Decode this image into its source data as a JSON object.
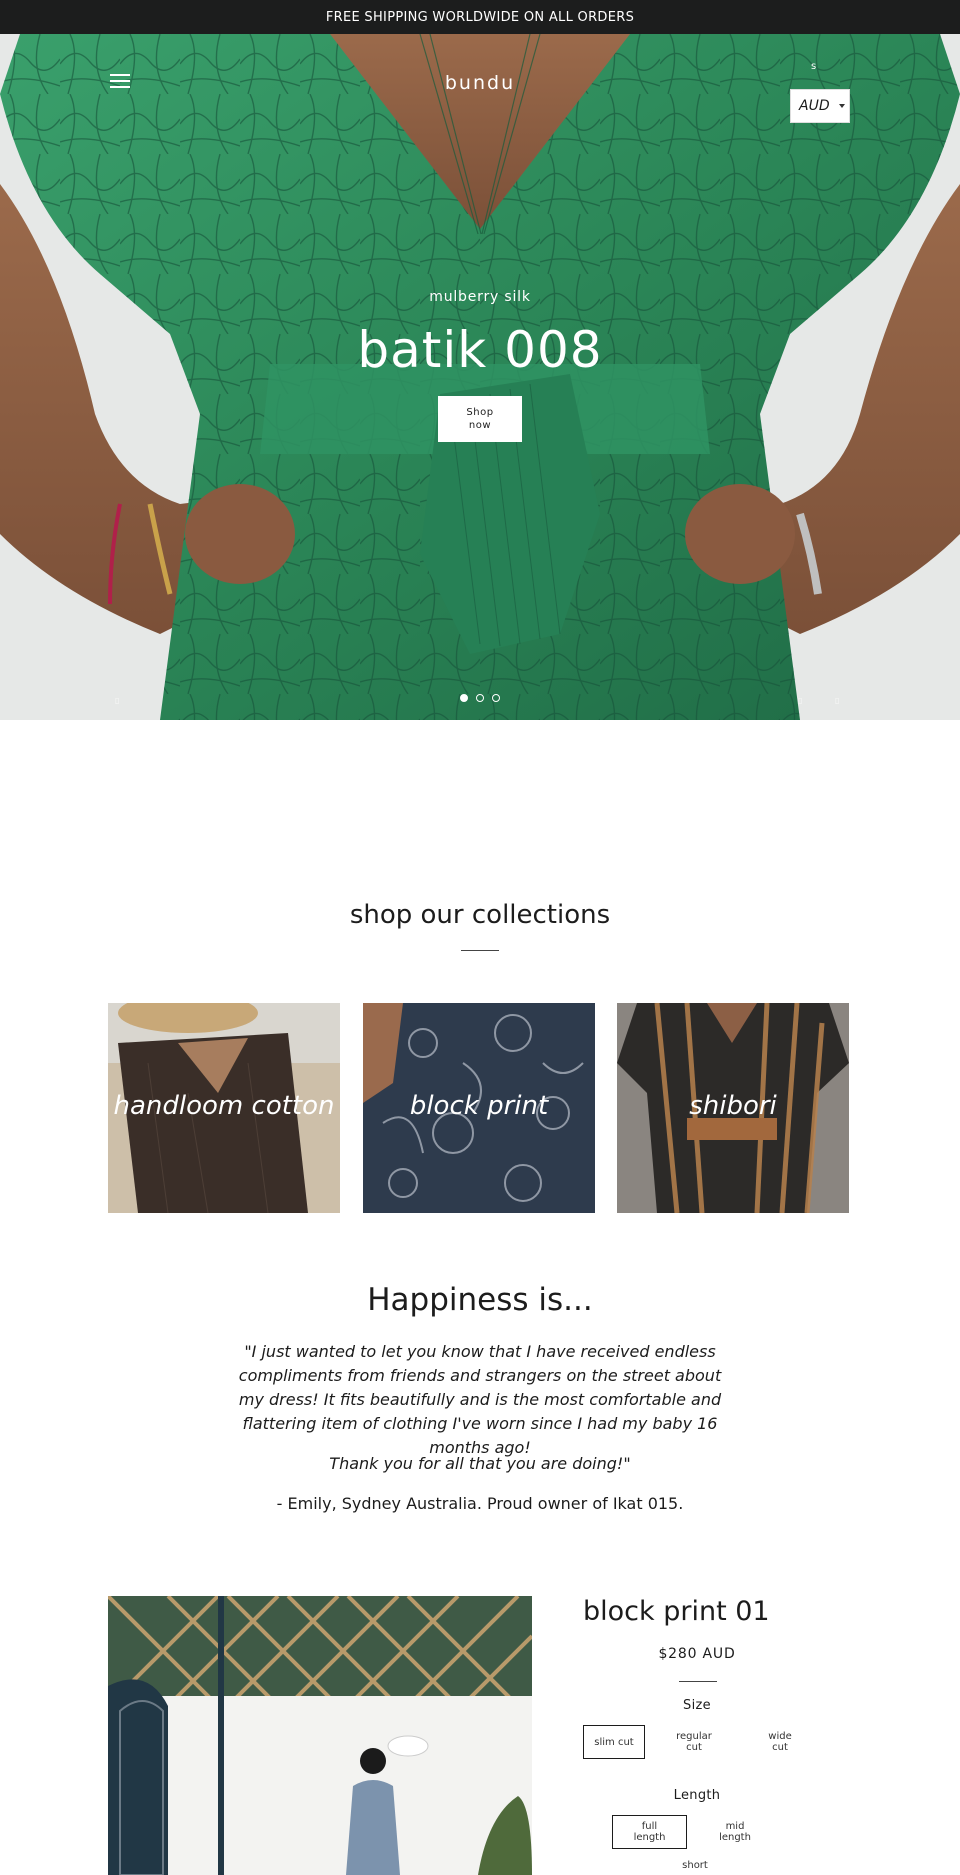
{
  "announcement": "FREE SHIPPING WORLDWIDE ON ALL ORDERS",
  "header": {
    "logo": "bundu",
    "cart_count": "s",
    "currency": "AUD"
  },
  "hero": {
    "subtitle": "mulberry silk",
    "title": "batik 008",
    "button": "Shop now",
    "slides_total": 3,
    "active_slide": 1
  },
  "collections": {
    "title": "shop our collections",
    "items": [
      {
        "label": "handloom cotton"
      },
      {
        "label": "block print"
      },
      {
        "label": "shibori"
      }
    ]
  },
  "testimonial": {
    "title": "Happiness is...",
    "quote": "\"I just wanted to let you know that I have received endless compliments from friends and strangers on the street about my dress! It fits beautifully and is the most comfortable and flattering item of clothing I've worn since I had my baby 16 months ago!",
    "quote2": "Thank you for all that you are doing!\"",
    "attribution": "- Emily, Sydney Australia. Proud owner of Ikat 015."
  },
  "product": {
    "title": "block print 01",
    "price": "$280 AUD",
    "size_label": "Size",
    "sizes": [
      "slim cut",
      "regular cut",
      "wide cut"
    ],
    "selected_size": "slim cut",
    "length_label": "Length",
    "lengths": [
      "full length",
      "mid length",
      "short"
    ],
    "selected_length": "full length"
  },
  "colors": {
    "announcement_bg": "#1c1d1d",
    "dress_green": "#2e8a5a",
    "text": "#1c1c1c"
  }
}
